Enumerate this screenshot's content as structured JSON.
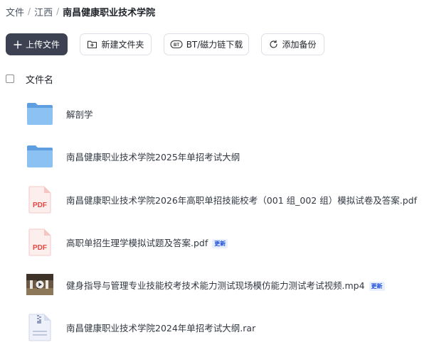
{
  "breadcrumb": {
    "root": "文件",
    "parent": "江西",
    "current": "南昌健康职业技术学院",
    "separator": "/"
  },
  "toolbar": {
    "upload_label": "上传文件",
    "new_folder_label": "新建文件夹",
    "bt_label": "BT/磁力链下载",
    "backup_label": "添加备份"
  },
  "table": {
    "column_name": "文件名"
  },
  "files": [
    {
      "name": "解剖学",
      "type": "folder",
      "icon": "folder-icon"
    },
    {
      "name": "南昌健康职业技术学院2025年单招考试大纲",
      "type": "folder",
      "icon": "folder-icon"
    },
    {
      "name": "南昌健康职业技术学院2026年高职单招技能校考（001 组_002 组）模拟试卷及答案.pdf",
      "type": "pdf",
      "icon": "pdf-icon"
    },
    {
      "name": "高职单招生理学模拟试题及答案.pdf",
      "type": "pdf",
      "icon": "pdf-icon",
      "badge": "更新"
    },
    {
      "name": "健身指导与管理专业技能校考技术能力测试现场模仿能力测试考试视频.mp4",
      "type": "video",
      "icon": "video-thumbnail-icon",
      "badge": "更新"
    },
    {
      "name": "南昌健康职业技术学院2024年单招考试大纲.rar",
      "type": "archive",
      "icon": "archive-icon"
    }
  ],
  "colors": {
    "primary_button": "#3d4253",
    "folder": "#7fb8ef",
    "pdf_red": "#e2483f",
    "badge_text": "#1d4ed8",
    "badge_bg": "#e8f0ff"
  }
}
